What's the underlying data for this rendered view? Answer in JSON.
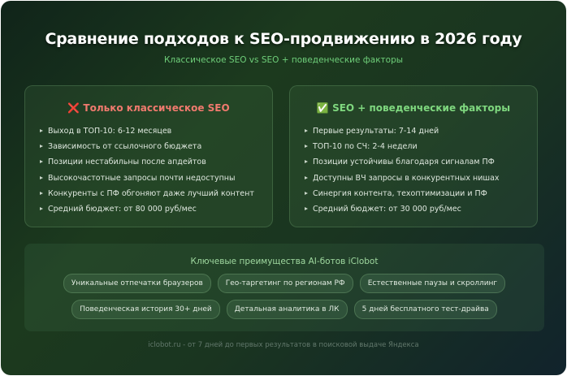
{
  "header": {
    "title": "Сравнение подходов к SEO-продвижению в 2026 году",
    "subtitle": "Классическое SEO vs SEO + поведенческие факторы"
  },
  "classic": {
    "icon": "cross-icon",
    "icon_glyph": "❌",
    "title": "Только классическое SEO",
    "items": [
      "Выход в ТОП-10: 6-12 месяцев",
      "Зависимость от ссылочного бюджета",
      "Позиции нестабильны после апдейтов",
      "Высокочастотные запросы почти недоступны",
      "Конкуренты с ПФ обгоняют даже лучший контент",
      "Средний бюджет: от 80 000 руб/мес"
    ]
  },
  "behavioral": {
    "icon": "check-icon",
    "icon_glyph": "✅",
    "title": "SEO + поведенческие факторы",
    "items": [
      "Первые результаты: 7-14 дней",
      "ТОП-10 по СЧ: 2-4 недели",
      "Позиции устойчивы благодаря сигналам ПФ",
      "Доступны ВЧ запросы в конкурентных нишах",
      "Синергия контента, техоптимизации и ПФ",
      "Средний бюджет: от 30 000 руб/мес"
    ]
  },
  "features": {
    "title": "Ключевые преимущества AI-ботов iClobot",
    "row1": [
      "Уникальные отпечатки браузеров",
      "Гео-таргетинг по регионам РФ",
      "Естественные паузы и скроллинг"
    ],
    "row2": [
      "Поведенческая история 30+ дней",
      "Детальная аналитика в ЛК",
      "5 дней бесплатного тест-драйва"
    ]
  },
  "footer": "iclobot.ru - от 7 дней до первых результатов в поисковой выдаче Яндекса",
  "colors": {
    "negative": "#f07a6e",
    "positive": "#7fd87f",
    "subtitle": "#6fcf7a"
  }
}
